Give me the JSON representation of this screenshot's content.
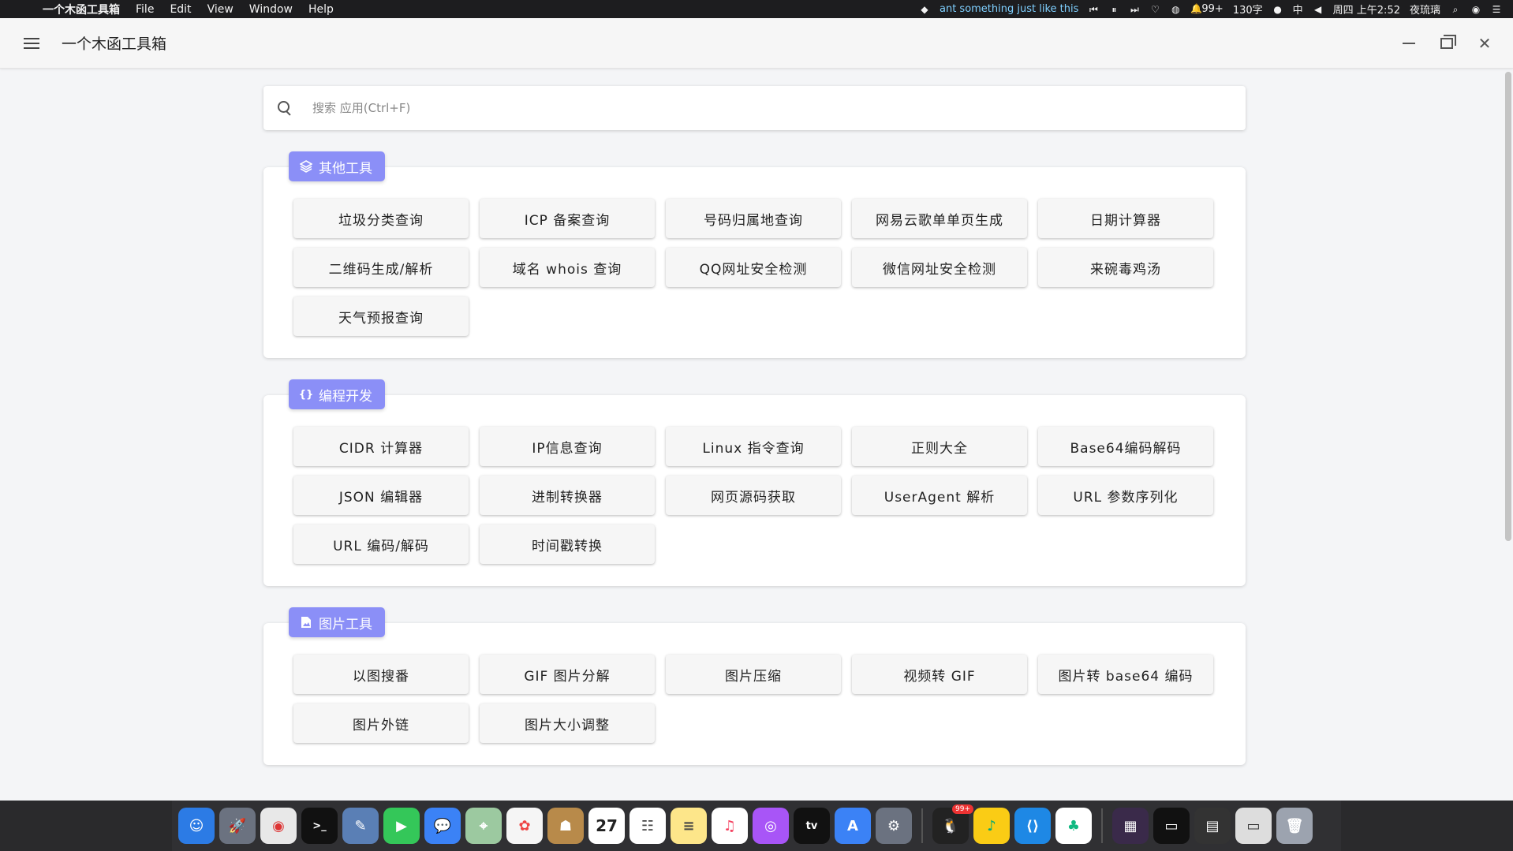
{
  "menubar": {
    "app_name": "一个木函工具箱",
    "menus": [
      "File",
      "Edit",
      "View",
      "Window",
      "Help"
    ],
    "now_playing": "ant something just like this",
    "notification_count": "99+",
    "stats": "130字",
    "input_method": "中",
    "datetime": "周四 上午2:52",
    "user": "夜琉璃"
  },
  "window": {
    "title": "一个木函工具箱"
  },
  "search": {
    "placeholder": "搜索 应用(Ctrl+F)"
  },
  "sections": [
    {
      "title": "其他工具",
      "icon": "layers-icon",
      "tools": [
        "垃圾分类查询",
        "ICP 备案查询",
        "号码归属地查询",
        "网易云歌单单页生成",
        "日期计算器",
        "二维码生成/解析",
        "域名 whois 查询",
        "QQ网址安全检测",
        "微信网址安全检测",
        "来碗毒鸡汤",
        "天气预报查询"
      ]
    },
    {
      "title": "编程开发",
      "icon": "code-braces-icon",
      "tools": [
        "CIDR 计算器",
        "IP信息查询",
        "Linux 指令查询",
        "正则大全",
        "Base64编码解码",
        "JSON 编辑器",
        "进制转换器",
        "网页源码获取",
        "UserAgent 解析",
        "URL 参数序列化",
        "URL 编码/解码",
        "时间戳转换"
      ]
    },
    {
      "title": "图片工具",
      "icon": "image-file-icon",
      "tools": [
        "以图搜番",
        "GIF 图片分解",
        "图片压缩",
        "视频转 GIF",
        "图片转 base64 编码",
        "图片外链",
        "图片大小调整"
      ]
    }
  ],
  "dock": {
    "badge_qq": "99+"
  },
  "colors": {
    "chip": "#8b8ff7",
    "background": "#f4f5f7"
  }
}
